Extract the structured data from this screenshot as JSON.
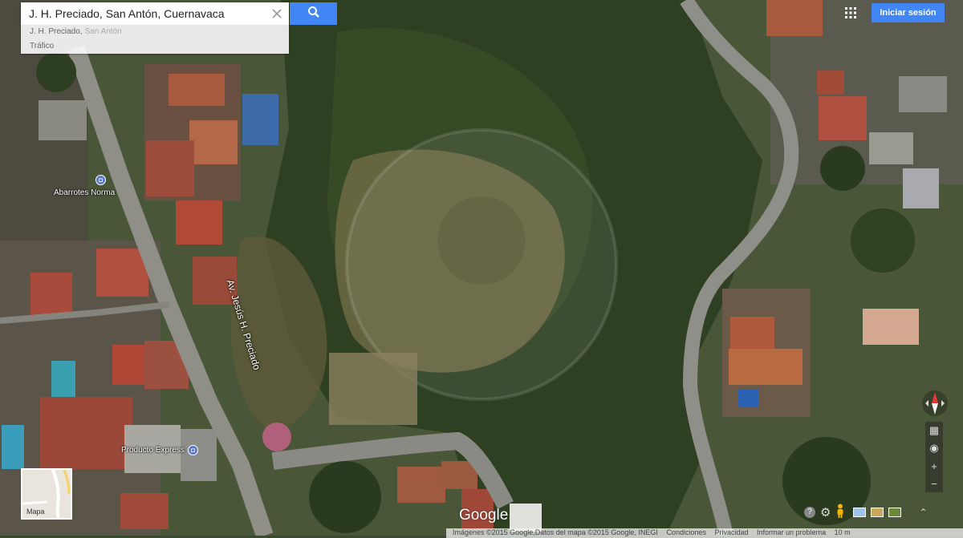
{
  "search": {
    "value": "J. H. Preciado, San Antón, Cuernavaca"
  },
  "suggestions": [
    {
      "main": "J. H. Preciado,",
      "sub": "San Antón"
    },
    {
      "main": "Tráfico",
      "sub": ""
    }
  ],
  "header": {
    "signin_label": "Iniciar sesión"
  },
  "places": [
    {
      "name": "Abarrotes Norma"
    },
    {
      "name": "Producto Express"
    }
  ],
  "street": {
    "name": "Av. Jesús H. Preciado"
  },
  "minimap": {
    "label": "Mapa"
  },
  "logo": "Google",
  "footer": {
    "attribution": "Imágenes ©2015 Google,Datos del mapa ©2015 Google, INEGI",
    "terms": "Condiciones",
    "privacy": "Privacidad",
    "report": "Informar un problema",
    "scale": "10 m"
  },
  "icons": {
    "clear": "close-icon",
    "search": "search-icon",
    "apps": "apps-grid-icon",
    "compass": "compass-icon",
    "pegman": "pegman-icon",
    "help": "help-icon",
    "settings": "gear-icon"
  }
}
